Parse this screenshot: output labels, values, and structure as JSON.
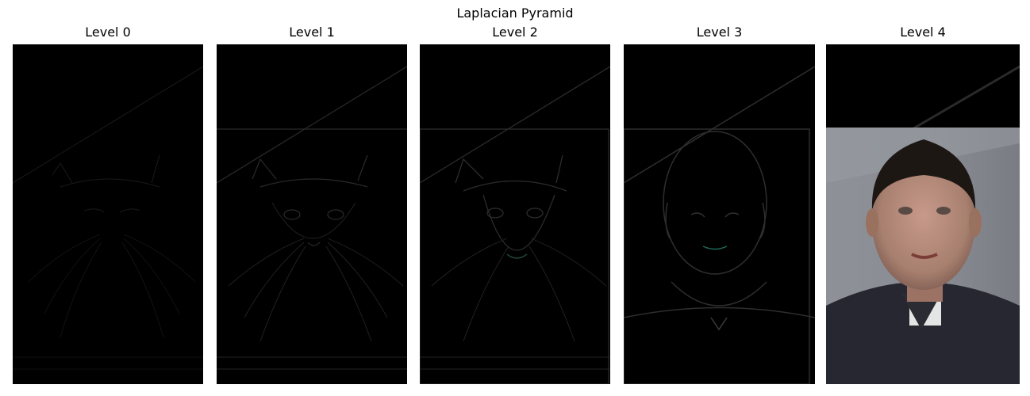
{
  "figure": {
    "title": "Laplacian Pyramid"
  },
  "panels": [
    {
      "title": "Level 0",
      "content": "edge-detail-cat-faint"
    },
    {
      "title": "Level 1",
      "content": "edge-detail-cat"
    },
    {
      "title": "Level 2",
      "content": "edge-detail-cat-man-blend"
    },
    {
      "title": "Level 3",
      "content": "edge-detail-man"
    },
    {
      "title": "Level 4",
      "content": "low-resolution-man-portrait"
    }
  ],
  "colors": {
    "background": "#ffffff",
    "image_black": "#000000",
    "portrait_bg_gray": "#8a8d94",
    "portrait_shirt": "#24252b",
    "portrait_skin": "#b58a7c",
    "portrait_hair": "#1c1614"
  }
}
